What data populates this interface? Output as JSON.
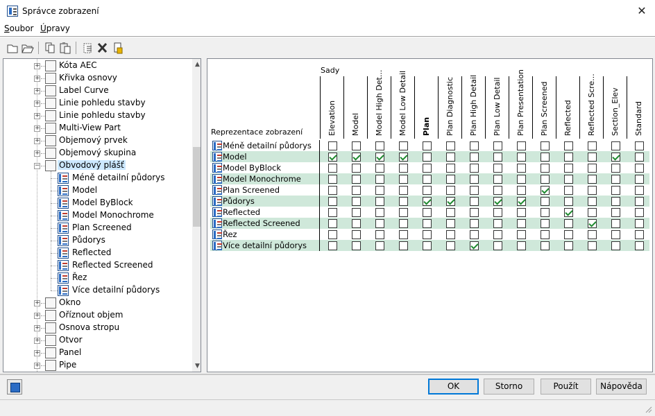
{
  "window": {
    "title": "Správce zobrazení",
    "close": "✕"
  },
  "menu": [
    "Soubor",
    "Úpravy"
  ],
  "toolbar": [
    {
      "icon": "new-icon"
    },
    {
      "icon": "open-icon"
    },
    {
      "icon": "copy-icon"
    },
    {
      "icon": "paste-icon"
    },
    {
      "icon": "purge-icon"
    },
    {
      "icon": "delete-icon"
    },
    {
      "icon": "properties-icon"
    }
  ],
  "tree": {
    "items": [
      {
        "label": "Kóta AEC",
        "level": 0,
        "expander": "+"
      },
      {
        "label": "Křivka osnovy",
        "level": 0,
        "expander": "+"
      },
      {
        "label": "Label Curve",
        "level": 0,
        "expander": "+"
      },
      {
        "label": "Linie pohledu stavby",
        "level": 0,
        "expander": "+"
      },
      {
        "label": "Linie pohledu stavby",
        "level": 0,
        "expander": "+"
      },
      {
        "label": "Multi-View Part",
        "level": 0,
        "expander": "+"
      },
      {
        "label": "Objemový prvek",
        "level": 0,
        "expander": "+"
      },
      {
        "label": "Objemový skupina",
        "level": 0,
        "expander": "+"
      },
      {
        "label": "Obvodový plášť",
        "level": 0,
        "expander": "−",
        "selected": true
      },
      {
        "label": "Méně detailní půdorys",
        "level": 1
      },
      {
        "label": "Model",
        "level": 1
      },
      {
        "label": "Model ByBlock",
        "level": 1
      },
      {
        "label": "Model Monochrome",
        "level": 1
      },
      {
        "label": "Plan Screened",
        "level": 1
      },
      {
        "label": "Půdorys",
        "level": 1
      },
      {
        "label": "Reflected",
        "level": 1
      },
      {
        "label": "Reflected Screened",
        "level": 1
      },
      {
        "label": "Řez",
        "level": 1
      },
      {
        "label": "Více detailní půdorys",
        "level": 1
      },
      {
        "label": "Okno",
        "level": 0,
        "expander": "+"
      },
      {
        "label": "Oříznout objem",
        "level": 0,
        "expander": "+"
      },
      {
        "label": "Osnova stropu",
        "level": 0,
        "expander": "+"
      },
      {
        "label": "Otvor",
        "level": 0,
        "expander": "+"
      },
      {
        "label": "Panel",
        "level": 0,
        "expander": "+"
      },
      {
        "label": "Pipe",
        "level": 0,
        "expander": "+"
      }
    ]
  },
  "grid": {
    "sets_label": "Sady",
    "rows_label": "Reprezentace zobrazení",
    "columns": [
      "Elevation",
      "Model",
      "Model High Det...",
      "Model Low Detail",
      "Plan",
      "Plan Diagnostic",
      "Plan High Detail",
      "Plan Low Detail",
      "Plan Presentation",
      "Plan Screened",
      "Reflected",
      "Reflected Scre...",
      "Section_Elev",
      "Standard"
    ],
    "bold_column": 4,
    "rows": [
      {
        "label": "Méně detailní půdorys",
        "checks": [
          0,
          0,
          0,
          0,
          0,
          0,
          0,
          0,
          0,
          0,
          0,
          0,
          0,
          0
        ]
      },
      {
        "label": "Model",
        "checks": [
          1,
          1,
          1,
          1,
          0,
          0,
          0,
          0,
          0,
          0,
          0,
          0,
          1,
          0
        ]
      },
      {
        "label": "Model ByBlock",
        "checks": [
          0,
          0,
          0,
          0,
          0,
          0,
          0,
          0,
          0,
          0,
          0,
          0,
          0,
          0
        ]
      },
      {
        "label": "Model Monochrome",
        "checks": [
          0,
          0,
          0,
          0,
          0,
          0,
          0,
          0,
          0,
          0,
          0,
          0,
          0,
          0
        ]
      },
      {
        "label": "Plan Screened",
        "checks": [
          0,
          0,
          0,
          0,
          0,
          0,
          0,
          0,
          0,
          1,
          0,
          0,
          0,
          0
        ]
      },
      {
        "label": "Půdorys",
        "checks": [
          0,
          0,
          0,
          0,
          1,
          1,
          0,
          1,
          1,
          0,
          0,
          0,
          0,
          0
        ]
      },
      {
        "label": "Reflected",
        "checks": [
          0,
          0,
          0,
          0,
          0,
          0,
          0,
          0,
          0,
          0,
          1,
          0,
          0,
          0
        ]
      },
      {
        "label": "Reflected Screened",
        "checks": [
          0,
          0,
          0,
          0,
          0,
          0,
          0,
          0,
          0,
          0,
          0,
          1,
          0,
          0
        ]
      },
      {
        "label": "Řez",
        "checks": [
          0,
          0,
          0,
          0,
          0,
          0,
          0,
          0,
          0,
          0,
          0,
          0,
          0,
          0
        ]
      },
      {
        "label": "Více detailní půdorys",
        "checks": [
          0,
          0,
          0,
          0,
          0,
          0,
          1,
          0,
          0,
          0,
          0,
          0,
          0,
          0
        ]
      }
    ]
  },
  "buttons": {
    "ok": "OK",
    "cancel": "Storno",
    "apply": "Použít",
    "help": "Nápověda"
  },
  "colors": {
    "row_highlight": "#cfe8da",
    "check": "#1e8a2f",
    "selection": "#cce8ff",
    "accent": "#0078d7"
  }
}
